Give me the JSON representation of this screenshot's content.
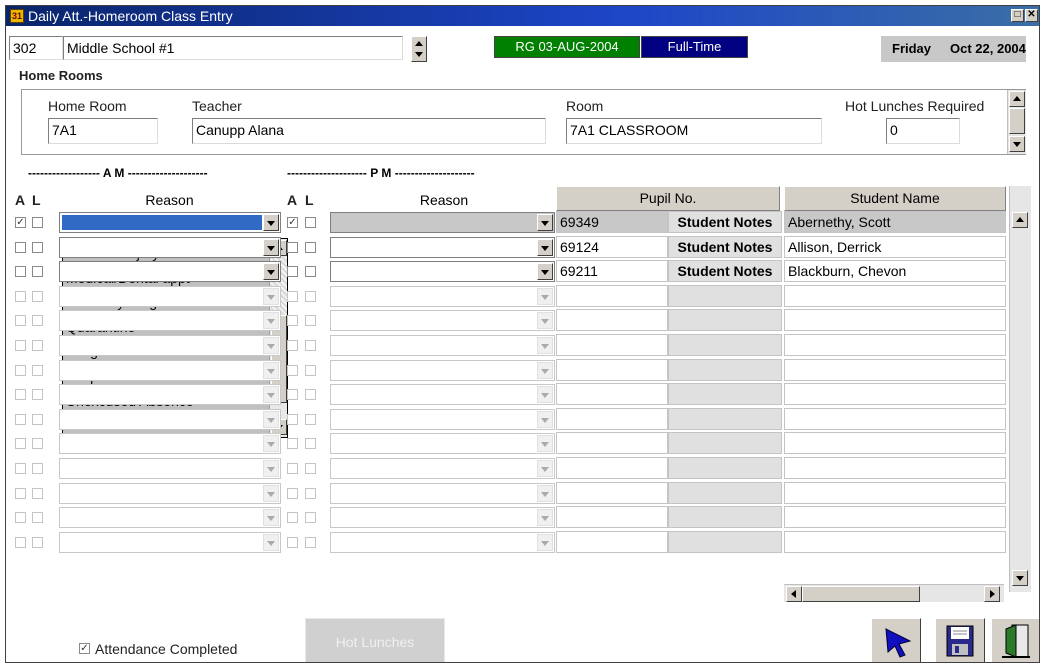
{
  "window": {
    "title": "Daily Att.-Homeroom Class Entry",
    "app_icon": "calendar-app-icon",
    "restore_glyph": "□",
    "close_glyph": "✕"
  },
  "school": {
    "code": "302",
    "name": "Middle School #1"
  },
  "status": {
    "rg_label": "RG 03-AUG-2004",
    "mode_label": "Full-Time",
    "day": "Friday",
    "date": "Oct 22, 2004",
    "rg_color": "#008000",
    "mode_color": "#000080"
  },
  "homerooms": {
    "section_label": "Home Rooms",
    "labels": {
      "home_room": "Home Room",
      "teacher": "Teacher",
      "room": "Room",
      "hot_lunches": "Hot Lunches Required"
    },
    "values": {
      "home_room": "7A1",
      "teacher": "Canupp Alana",
      "room": "7A1 CLASSROOM",
      "hot_lunches": "0"
    }
  },
  "grid": {
    "am_divider": "------------------ A  M --------------------",
    "pm_divider": "-------------------- P  M --------------------",
    "am_a": "A",
    "am_l": "L",
    "am_reason": "Reason",
    "pm_a": "A",
    "pm_l": "L",
    "pm_reason": "Reason",
    "pupil_no": "Pupil No.",
    "student_name": "Student Name",
    "rows": [
      {
        "am_absent": true,
        "pm_absent": true,
        "pupil_no": "69349",
        "notes": "Student Notes",
        "name": "Abernethy, Scott",
        "selected": true
      },
      {
        "am_absent": false,
        "pm_absent": false,
        "pupil_no": "69124",
        "notes": "Student Notes",
        "name": "Allison, Derrick"
      },
      {
        "am_absent": false,
        "pm_absent": false,
        "pupil_no": "69211",
        "notes": "Student Notes",
        "name": "Blackburn, Chevon"
      },
      {
        "pupil_no": "",
        "notes": "",
        "name": ""
      },
      {
        "pupil_no": "",
        "notes": "",
        "name": ""
      },
      {
        "pupil_no": "",
        "notes": "",
        "name": ""
      },
      {
        "pupil_no": "",
        "notes": "",
        "name": ""
      },
      {
        "pupil_no": "",
        "notes": "",
        "name": ""
      },
      {
        "pupil_no": "",
        "notes": "",
        "name": ""
      },
      {
        "pupil_no": "",
        "notes": "",
        "name": ""
      },
      {
        "pupil_no": "",
        "notes": "",
        "name": ""
      },
      {
        "pupil_no": "",
        "notes": "",
        "name": ""
      },
      {
        "pupil_no": "",
        "notes": "",
        "name": ""
      },
      {
        "pupil_no": "",
        "notes": "",
        "name": ""
      }
    ]
  },
  "reason_dropdown": {
    "options": [
      "Illness or injury",
      "Medical/Dental appt",
      "Medically Fragile",
      "Quarantine",
      "Religious observance",
      "Suspensions",
      "Unexcused Absence",
      "Unexcused Late"
    ]
  },
  "footer": {
    "attendance_completed_label": "Attendance Completed",
    "attendance_completed": true,
    "hot_lunches_button": "Hot Lunches",
    "icons": [
      "pointer-arrow-icon",
      "save-disk-icon",
      "exit-door-icon"
    ]
  }
}
